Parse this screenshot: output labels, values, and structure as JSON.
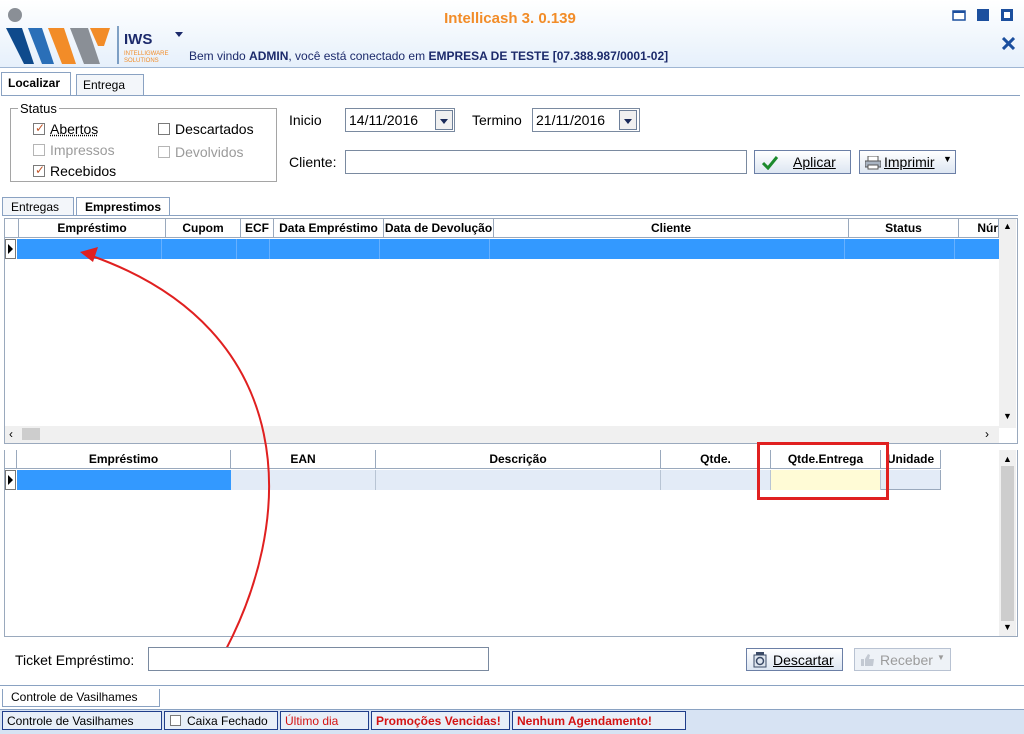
{
  "app": {
    "title": "Intellicash 3. 0.139",
    "logo_text": "IWS",
    "logo_sub1": "INTELLIGWARE",
    "logo_sub2": "SOLUTIONS",
    "welcome_prefix": "Bem vindo ",
    "welcome_user": "ADMIN",
    "welcome_mid": ", você está conectado em ",
    "welcome_company": "EMPRESA DE TESTE [07.388.987/0001-02]"
  },
  "tabs": [
    "Localizar",
    "Entrega"
  ],
  "filters": {
    "status_label": "Status",
    "status_options": [
      {
        "label": "Abertos",
        "checked": true,
        "disabled": false
      },
      {
        "label": "Impressos",
        "checked": false,
        "disabled": true
      },
      {
        "label": "Recebidos",
        "checked": true,
        "disabled": false
      },
      {
        "label": "Descartados",
        "checked": false,
        "disabled": false
      },
      {
        "label": "Devolvidos",
        "checked": false,
        "disabled": true
      }
    ],
    "inicio_label": "Inicio",
    "inicio_value": "14/11/2016",
    "termino_label": "Termino",
    "termino_value": "21/11/2016",
    "cliente_label": "Cliente:",
    "cliente_value": "",
    "aplicar_label": "Aplicar",
    "imprimir_label": "Imprimir"
  },
  "inner_tabs": [
    "Entregas",
    "Emprestimos"
  ],
  "grid_top": {
    "columns": [
      "Empréstimo",
      "Cupom",
      "ECF",
      "Data Empréstimo",
      "Data de Devolução",
      "Cliente",
      "Status",
      "Núr"
    ]
  },
  "grid_bottom": {
    "columns": [
      "Empréstimo",
      "EAN",
      "Descrição",
      "Qtde.",
      "Qtde.Entrega",
      "Unidade"
    ]
  },
  "ticket": {
    "label": "Ticket Empréstimo:",
    "value": "",
    "descartar_label": "Descartar",
    "receber_label": "Receber"
  },
  "bottom_tab": "Controle de Vasilhames",
  "statusbar": {
    "module": "Controle de Vasilhames",
    "caixa": "Caixa Fechado",
    "ultimo_dia": "Último dia",
    "promocoes": "Promoções Vencidas!",
    "agendamento": "Nenhum Agendamento!"
  },
  "colors": {
    "accent_orange": "#f28c28",
    "selection_blue": "#3399ff",
    "annotation_red": "#e02020",
    "highlight_cell": "#fffbd6"
  }
}
